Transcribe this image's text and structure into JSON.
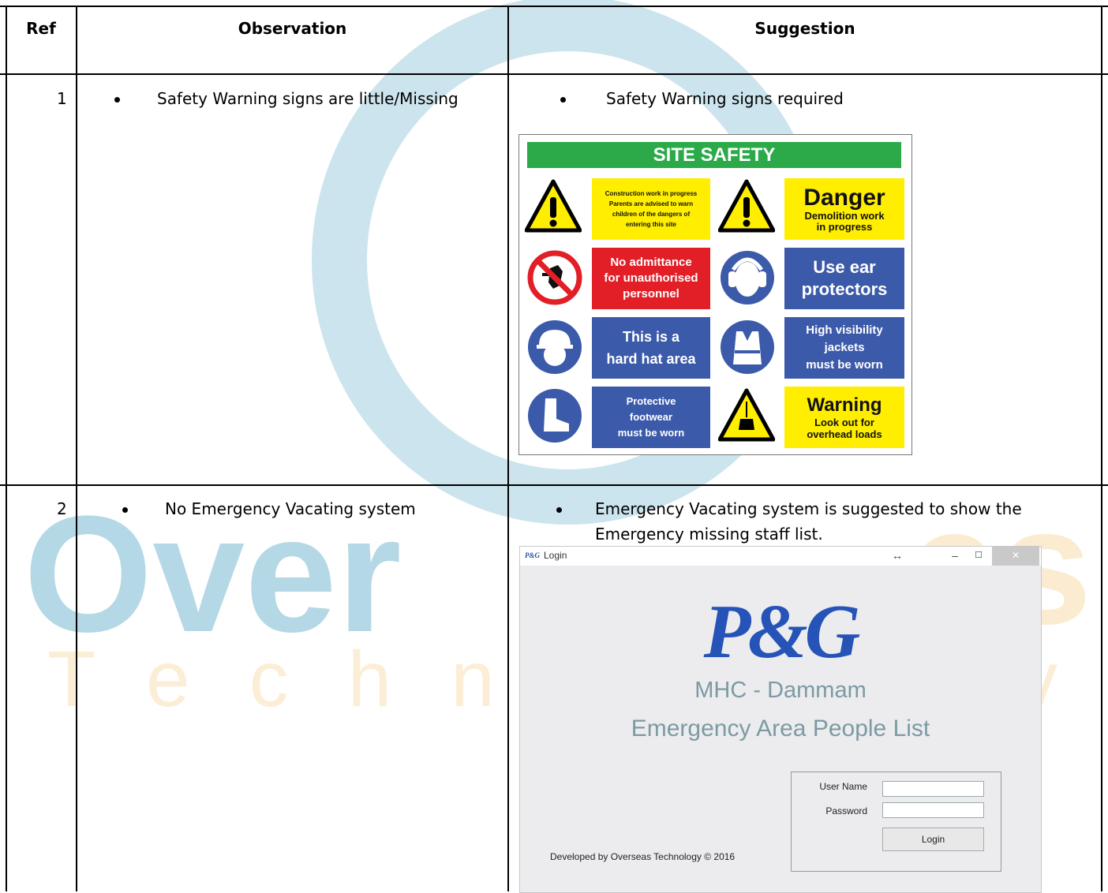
{
  "table": {
    "headers": [
      "Ref",
      "Observation",
      "Suggestion"
    ],
    "rows": [
      {
        "ref": "1",
        "observation": "Safety Warning signs are little/Missing",
        "suggestion": "Safety Warning signs required"
      },
      {
        "ref": "2",
        "observation": "No Emergency Vacating system",
        "suggestion_line1": "Emergency Vacating system is suggested to show the",
        "suggestion_line2": "Emergency missing staff list."
      }
    ]
  },
  "watermark": {
    "word1": "Over",
    "word2": "Techn",
    "trail": "es",
    "trail2": "y",
    "blue": "#4a9fbf",
    "orange": "#f3b54a"
  },
  "sign": {
    "title": "SITE SAFETY",
    "panels": [
      {
        "lines": [
          "Construction work in progress",
          "Parents are advised to warn",
          "children of the dangers of",
          "entering this site"
        ]
      },
      {
        "big": "Danger",
        "lines": [
          "Demolition work",
          "in progress"
        ]
      },
      {
        "lines": [
          "No admittance",
          "for unauthorised",
          "personnel"
        ]
      },
      {
        "lines": [
          "Use ear",
          "protectors"
        ]
      },
      {
        "lines": [
          "This is a",
          "hard hat area"
        ]
      },
      {
        "lines": [
          "High visibility",
          "jackets",
          "must be worn"
        ]
      },
      {
        "lines": [
          "Protective",
          "footwear",
          "must be worn"
        ]
      },
      {
        "big": "Warning",
        "lines": [
          "Look out for",
          "overhead loads"
        ]
      }
    ]
  },
  "login_window": {
    "logo_small": "P&G",
    "title": "Login",
    "resize_glyph": "↔",
    "minimize": "–",
    "maximize": "☐",
    "close": "✕",
    "brand": "P&G",
    "subtitle1": "MHC - Dammam",
    "subtitle2": "Emergency Area People List",
    "username_label": "User Name",
    "password_label": "Password",
    "login_button": "Login",
    "footer": "Developed by Overseas Technology © 2016"
  }
}
